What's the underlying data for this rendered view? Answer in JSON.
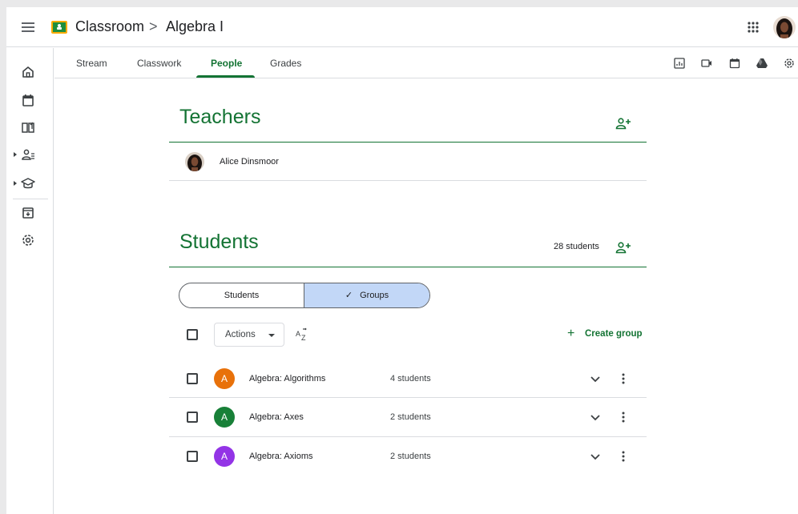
{
  "header": {
    "app_name": "Classroom",
    "separator": ">",
    "class_name": "Algebra I",
    "icons": [
      "menu-icon",
      "classroom-logo",
      "apps-grid-icon",
      "avatar"
    ]
  },
  "sidebar": {
    "items": [
      {
        "icon": "home-icon"
      },
      {
        "icon": "calendar-icon"
      },
      {
        "icon": "book-icon"
      },
      {
        "icon": "people-icon",
        "expandable": true
      },
      {
        "icon": "school-cap-icon",
        "expandable": true
      },
      {
        "icon": "archive-icon"
      },
      {
        "icon": "settings-icon"
      }
    ]
  },
  "tabs": [
    {
      "label": "Stream",
      "active": false
    },
    {
      "label": "Classwork",
      "active": false
    },
    {
      "label": "People",
      "active": true
    },
    {
      "label": "Grades",
      "active": false
    }
  ],
  "toolbar": {
    "icons": [
      "gradebook-icon",
      "video-icon",
      "calendar-icon",
      "drive-icon",
      "settings-icon"
    ]
  },
  "teachers": {
    "title": "Teachers",
    "list": [
      {
        "name": "Alice Dinsmoor"
      }
    ]
  },
  "students": {
    "title": "Students",
    "count_label": "28 students",
    "toggle": {
      "left_label": "Students",
      "right_label": "Groups",
      "selected": "Groups",
      "check_glyph": "✓"
    },
    "actions_label": "Actions",
    "create_group_label": "Create group",
    "groups": [
      {
        "initial": "A",
        "name": "Algebra: Algorithms",
        "count": "4 students",
        "color": "#e8710a"
      },
      {
        "initial": "A",
        "name": "Algebra: Axes",
        "count": "2 students",
        "color": "#188038"
      },
      {
        "initial": "A",
        "name": "Algebra: Axioms",
        "count": "2 students",
        "color": "#9334e6"
      }
    ]
  },
  "colors": {
    "accent": "#137333",
    "toggle_selected": "#c2d7f7"
  }
}
